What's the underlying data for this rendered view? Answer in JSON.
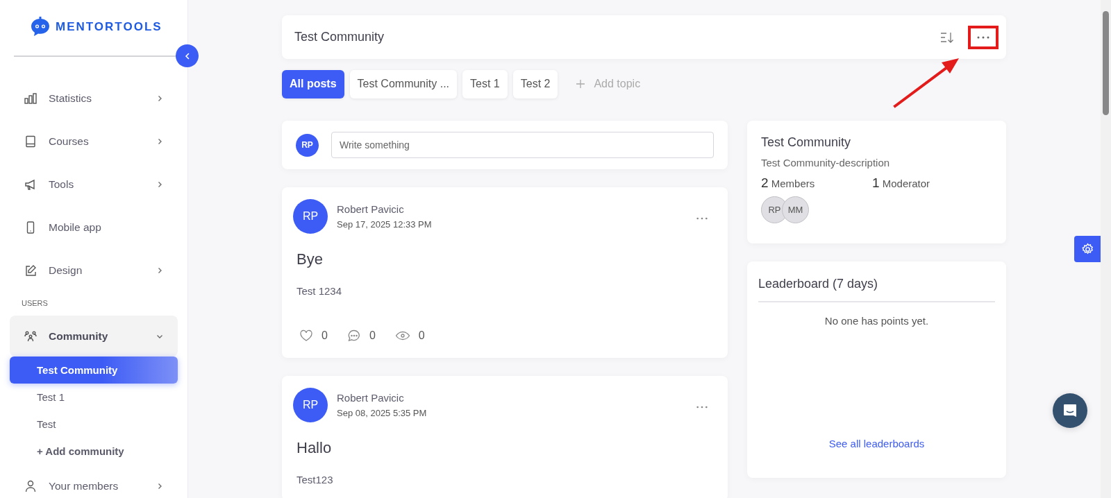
{
  "sidebar": {
    "logo_text": "MENTORTOOLS",
    "nav": [
      {
        "kind": "group",
        "label": "Statistics",
        "expanded": false
      },
      {
        "kind": "group",
        "label": "Courses",
        "expanded": false
      },
      {
        "kind": "group",
        "label": "Tools",
        "expanded": false
      },
      {
        "kind": "link",
        "label": "Mobile app"
      },
      {
        "kind": "group",
        "label": "Design",
        "expanded": false
      }
    ],
    "section_label": "USERS",
    "user_nav": [
      {
        "kind": "group",
        "label": "Community",
        "expanded": true,
        "children": [
          {
            "label": "Test Community",
            "selected": true
          },
          {
            "label": "Test 1",
            "selected": false
          },
          {
            "label": "Test",
            "selected": false
          }
        ],
        "add_label": "+ Add community"
      },
      {
        "kind": "group",
        "label": "Your members",
        "expanded": false
      }
    ]
  },
  "header": {
    "title": "Test Community"
  },
  "topics": [
    {
      "label": "All posts",
      "selected": true
    },
    {
      "label": "Test Community ...",
      "selected": false
    },
    {
      "label": "Test 1",
      "selected": false
    },
    {
      "label": "Test 2",
      "selected": false
    }
  ],
  "add_topic": "Add topic",
  "composer": {
    "avatar": "RP",
    "placeholder": "Write something"
  },
  "posts": [
    {
      "avatar": "RP",
      "author": "Robert Pavicic",
      "date": "Sep 17, 2025 12:33 PM",
      "title": "Bye",
      "body": "Test 1234",
      "likes": "0",
      "comments": "0",
      "views": "0"
    },
    {
      "avatar": "RP",
      "author": "Robert Pavicic",
      "date": "Sep 08, 2025 5:35 PM",
      "title": "Hallo",
      "body": "Test123"
    }
  ],
  "about": {
    "title": "Test Community",
    "description": "Test Community-description",
    "members_count": "2",
    "members_label": "Members",
    "moderators_count": "1",
    "moderators_label": "Moderator",
    "member_avatars": [
      "RP",
      "MM"
    ]
  },
  "leaderboard": {
    "title": "Leaderboard (7 days)",
    "empty_text": "No one has points yet.",
    "link": "See all leaderboards"
  }
}
